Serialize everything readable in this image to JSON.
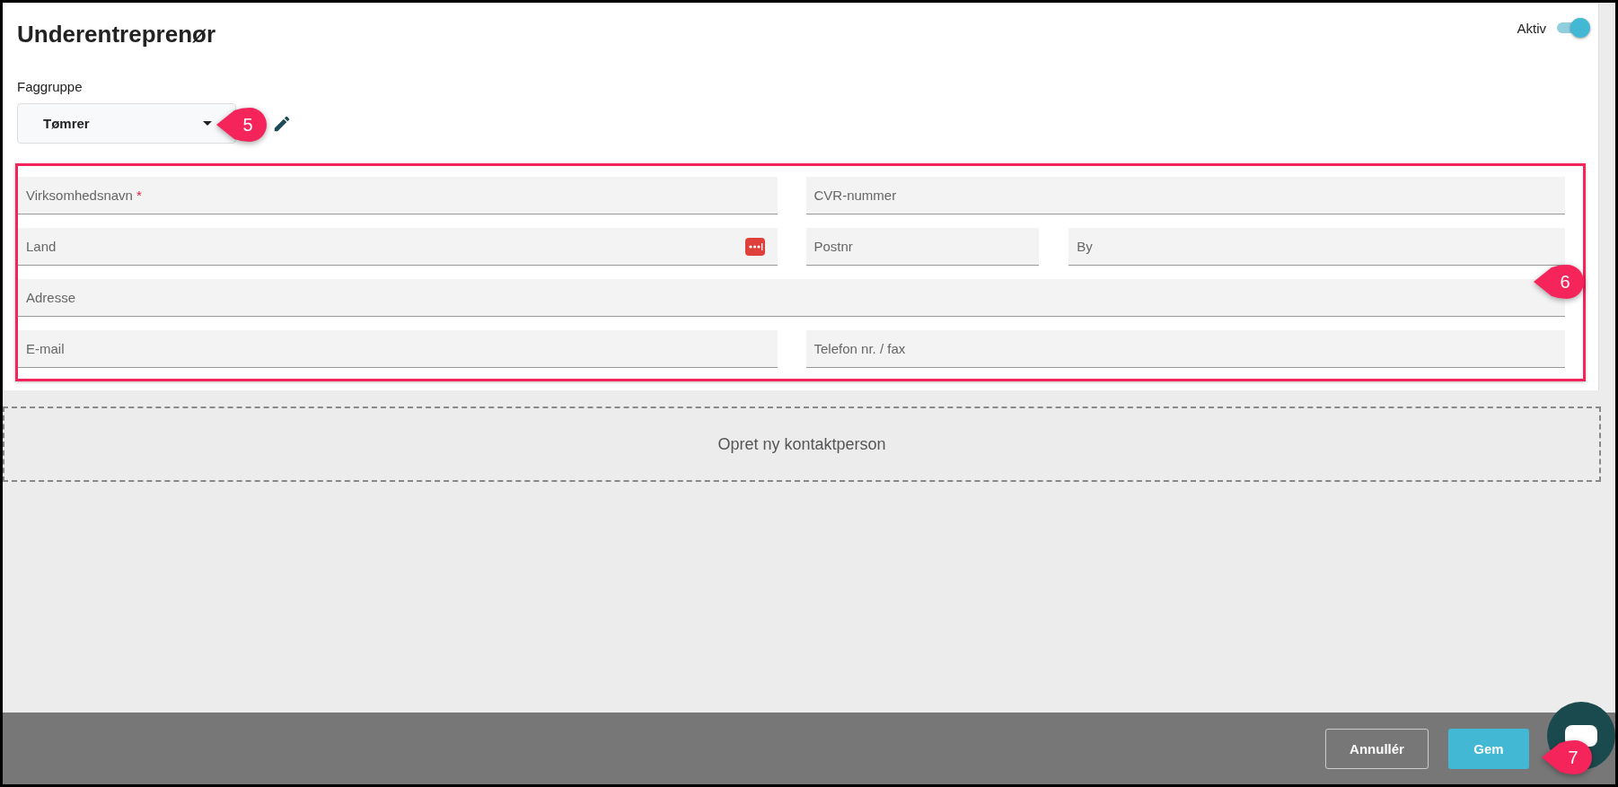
{
  "title": "Underentreprenør",
  "active_toggle": {
    "label": "Aktiv",
    "on": true
  },
  "trade_group": {
    "label": "Faggruppe",
    "value": "Tømrer"
  },
  "form_rows": [
    [
      {
        "placeholder": "Virksomhedsnavn",
        "required": true,
        "kind": "text"
      },
      {
        "placeholder": "CVR-nummer",
        "required": false,
        "kind": "text"
      }
    ],
    [
      {
        "placeholder": "Land",
        "required": false,
        "kind": "lookup"
      },
      {
        "placeholder": "Postnr",
        "required": false,
        "kind": "text"
      },
      {
        "placeholder": "By",
        "required": false,
        "kind": "text"
      }
    ],
    [
      {
        "placeholder": "Adresse",
        "required": false,
        "kind": "text"
      }
    ],
    [
      {
        "placeholder": "E-mail",
        "required": false,
        "kind": "text"
      },
      {
        "placeholder": "Telefon nr. / fax",
        "required": false,
        "kind": "text"
      }
    ]
  ],
  "required_marker": "*",
  "add_contact": "Opret ny kontaktperson",
  "buttons": [
    {
      "label": "Annullér",
      "kind": "secondary"
    },
    {
      "label": "Gem",
      "kind": "primary"
    }
  ],
  "callouts": [
    "5",
    "6",
    "7"
  ]
}
